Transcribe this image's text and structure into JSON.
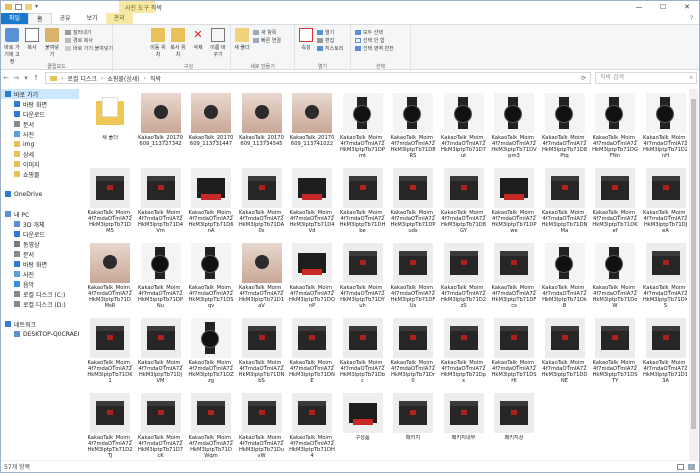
{
  "window": {
    "title": "직박",
    "context_tab": "사진 도구",
    "minimize": "—",
    "maximize": "☐",
    "close": "✕"
  },
  "ribbon_tabs": [
    "파일",
    "홈",
    "공유",
    "보기",
    "관리"
  ],
  "ribbon": {
    "clipboard": {
      "pin": "바로 가기에 고정",
      "copy": "복사",
      "paste": "붙여넣기",
      "cut": "잘라내기",
      "copy_path": "경로 복사",
      "paste_shortcut": "바로 가기 붙여넣기",
      "label": "클립보드"
    },
    "organize": {
      "move": "이동 위치",
      "copyto": "복사 위치",
      "delete": "삭제",
      "rename": "이름 바꾸기",
      "label": "구성"
    },
    "new": {
      "new_folder": "새 폴더",
      "new_item": "새 항목",
      "easy_access": "빠른 연결",
      "label": "새로 만들기"
    },
    "open": {
      "properties": "속성",
      "open": "열기",
      "edit": "편집",
      "history": "히스토리",
      "label": "열기"
    },
    "select": {
      "select_all": "모두 선택",
      "select_none": "선택 안 함",
      "invert": "선택 영역 반전",
      "label": "선택"
    }
  },
  "address": {
    "path": [
      "로컬 디스크",
      "쇼핑몰(상세)",
      "직박"
    ],
    "search_placeholder": "직박 검색"
  },
  "nav": [
    {
      "label": "바로 가기",
      "icon": "star-icon",
      "level": 0,
      "sel": true
    },
    {
      "label": "바탕 화면",
      "icon": "desktop-icon",
      "level": 1
    },
    {
      "label": "다운로드",
      "icon": "download-icon",
      "level": 1
    },
    {
      "label": "문서",
      "icon": "document-icon",
      "level": 1
    },
    {
      "label": "사진",
      "icon": "picture-icon",
      "level": 1
    },
    {
      "label": "img",
      "icon": "folder-icon",
      "level": 1
    },
    {
      "label": "상세",
      "icon": "folder-icon",
      "level": 1
    },
    {
      "label": "이미지",
      "icon": "folder-icon",
      "level": 1
    },
    {
      "label": "쇼핑몰",
      "icon": "folder-icon",
      "level": 1
    },
    {
      "label": "",
      "icon": "",
      "level": 0
    },
    {
      "label": "OneDrive",
      "icon": "cloud-icon",
      "level": 0
    },
    {
      "label": "",
      "icon": "",
      "level": 0
    },
    {
      "label": "내 PC",
      "icon": "pc-icon",
      "level": 0
    },
    {
      "label": "3D 개체",
      "icon": "cube-icon",
      "level": 1
    },
    {
      "label": "다운로드",
      "icon": "download-icon",
      "level": 1
    },
    {
      "label": "동영상",
      "icon": "video-icon",
      "level": 1
    },
    {
      "label": "문서",
      "icon": "document-icon",
      "level": 1
    },
    {
      "label": "바탕 화면",
      "icon": "desktop-icon",
      "level": 1
    },
    {
      "label": "사진",
      "icon": "picture-icon",
      "level": 1
    },
    {
      "label": "음악",
      "icon": "music-icon",
      "level": 1
    },
    {
      "label": "로컬 디스크 (C:)",
      "icon": "drive-icon",
      "level": 1
    },
    {
      "label": "로컬 디스크 (D:)",
      "icon": "drive-icon",
      "level": 1
    },
    {
      "label": "",
      "icon": "",
      "level": 0
    },
    {
      "label": "네트워크",
      "icon": "network-icon",
      "level": 0
    },
    {
      "label": "DESKTOP-Q0CRAEI",
      "icon": "pc-icon",
      "level": 1
    }
  ],
  "files": [
    {
      "name": "새 폴더",
      "kind": "folder"
    },
    {
      "name": "KakaoTalk_20170609_113727342",
      "kind": "hand"
    },
    {
      "name": "KakaoTalk_20170609_113731447",
      "kind": "hand"
    },
    {
      "name": "KakaoTalk_20170609_113734545",
      "kind": "hand"
    },
    {
      "name": "KakaoTalk_20170609_113741022",
      "kind": "hand"
    },
    {
      "name": "KakaoTalk_Moim_4f7mdaOTmIA72HkM3lptpTb71DPmt",
      "kind": "watch"
    },
    {
      "name": "KakaoTalk_Moim_4f7mdaOTmIA72HkM3lptpTb71D8RS",
      "kind": "watch"
    },
    {
      "name": "KakaoTalk_Moim_4f7mdaOTmIA72HkM3lptpTb71D7ut",
      "kind": "watch"
    },
    {
      "name": "KakaoTalk_Moim_4f7mdaOTmIA72HkM3lptpTb71DVpm3",
      "kind": "watch"
    },
    {
      "name": "KakaoTalk_Moim_4f7mdaOTmIA72HkM3lptpTb71D8Ptq",
      "kind": "watch"
    },
    {
      "name": "KakaoTalk_Moim_4f7mdaOTmIA72HkM3lptpTb71DGFNn",
      "kind": "watch"
    },
    {
      "name": "KakaoTalk_Moim_4f7mdaOTmIA72HkM3lptpTb71D2nH",
      "kind": "watch"
    },
    {
      "name": "KakaoTalk_Moim_4f7mdaOTmIA72HkM3lptpTb71DM5",
      "kind": "box"
    },
    {
      "name": "KakaoTalk_Moim_4f7mdaOTmIA72HkM3lptpTb71D4Vm",
      "kind": "box"
    },
    {
      "name": "KakaoTalk_Moim_4f7mdaOTmIA72HkM3lptpTb71D6nA",
      "kind": "redbox"
    },
    {
      "name": "KakaoTalk_Moim_4f7mdaOTmIA72HkM3lptpTb71DA0s",
      "kind": "box"
    },
    {
      "name": "KakaoTalk_Moim_4f7mdaOTmIA72HkM3lptpTb71D4Vd",
      "kind": "redbox"
    },
    {
      "name": "KakaoTalk_Moim_4f7mdaOTmIA72HkM3lptpTb71DHbe",
      "kind": "box"
    },
    {
      "name": "KakaoTalk_Moim_4f7mdaOTmIA72HkM3lptpTb71DPuds",
      "kind": "box"
    },
    {
      "name": "KakaoTalk_Moim_4f7mdaOTmIA72HkM3lptpTb71D8GY",
      "kind": "box"
    },
    {
      "name": "KakaoTalk_Moim_4f7mdaOTmIA72HkM3lptpTb71DPwe",
      "kind": "redbox"
    },
    {
      "name": "KakaoTalk_Moim_4f7mdaOTmIA72HkM3lptpTb71DNMa",
      "kind": "box"
    },
    {
      "name": "KakaoTalk_Moim_4f7mdaOTmIA72HkM3lptpTb71DKef",
      "kind": "box"
    },
    {
      "name": "KakaoTalk_Moim_4f7mdaOTmIA72HkM3lptpTb71DJeA",
      "kind": "box"
    },
    {
      "name": "KakaoTalk_Moim_4f7mdaOTmIA72HkM3lptpTb71DMsR",
      "kind": "hand"
    },
    {
      "name": "KakaoTalk_Moim_4f7mdaOTmIA72HkM3lptpTb71DPNu",
      "kind": "watch"
    },
    {
      "name": "KakaoTalk_Moim_4f7mdaOTmIA72HkM3lptpTb71DSqv",
      "kind": "watch"
    },
    {
      "name": "KakaoTalk_Moim_4f7mdaOTmIA72HkM3lptpTb71D1aV",
      "kind": "hand"
    },
    {
      "name": "KakaoTalk_Moim_4f7mdaOTmIA72HkM3lptpTb71DQnP",
      "kind": "redbox"
    },
    {
      "name": "KakaoTalk_Moim_4f7mdaOTmIA72HkM3lptpTb71DYuh",
      "kind": "box"
    },
    {
      "name": "KakaoTalk_Moim_4f7mdaOTmIA72HkM3lptpTb71DFUs",
      "kind": "box"
    },
    {
      "name": "KakaoTalk_Moim_4f7mdaOTmIA72HkM3lptpTb71D2zS",
      "kind": "box"
    },
    {
      "name": "KakaoTalk_Moim_4f7mdaOTmIA72HkM3lptpTb71DFcs",
      "kind": "box"
    },
    {
      "name": "KakaoTalk_Moim_4f7mdaOTmIA72HkM3lptpTb71DkB",
      "kind": "watch"
    },
    {
      "name": "KakaoTalk_Moim_4f7mdaOTmIA72HkM3lptpTb71DoW",
      "kind": "watch"
    },
    {
      "name": "KakaoTalk_Moim_4f7mdaOTmIA72HkM3lptpTb71DXS",
      "kind": "box"
    },
    {
      "name": "KakaoTalk_Moim_4f7mdaOTmIA72HkM3lptpTb71DK1",
      "kind": "box"
    },
    {
      "name": "KakaoTalk_Moim_4f7mdaOTmIA72HkM3lptpTb71DjVM",
      "kind": "box"
    },
    {
      "name": "KakaoTalk_Moim_4f7mdaOTmIA72HkM3lptpTb71DZzg",
      "kind": "watch"
    },
    {
      "name": "KakaoTalk_Moim_4f7mdaOTmIA72HkM3lptpTb71DNbS",
      "kind": "box"
    },
    {
      "name": "KakaoTalk_Moim_4f7mdaOTmIA72HkM3lptpTb71DNE",
      "kind": "box"
    },
    {
      "name": "KakaoTalk_Moim_4f7mdaOTmIA72HkM3lptpTb71Dbc",
      "kind": "box"
    },
    {
      "name": "KakaoTalk_Moim_4f7mdaOTmIA72HkM3lptpTb71Dr0",
      "kind": "box"
    },
    {
      "name": "KakaoTalk_Moim_4f7mdaOTmIA72HkM3lptpTb71Dpx",
      "kind": "box"
    },
    {
      "name": "KakaoTalk_Moim_4f7mdaOTmIA72HkM3lptpTb71DSHI",
      "kind": "box"
    },
    {
      "name": "KakaoTalk_Moim_4f7mdaOTmIA72HkM3lptpTb71DDNE",
      "kind": "box"
    },
    {
      "name": "KakaoTalk_Moim_4f7mdaOTmIA72HkM3lptpTb71DSTY",
      "kind": "box"
    },
    {
      "name": "KakaoTalk_Moim_4f7mdaOTmIA72HkM3lptpTb71D13A",
      "kind": "box"
    },
    {
      "name": "KakaoTalk_Moim_4f7mdaOTmIA72HkM3lptpTb71D2TJ",
      "kind": "box"
    },
    {
      "name": "KakaoTalk_Moim_4f7mdaOTmIA72HkM3lptpTb71D7cK",
      "kind": "box"
    },
    {
      "name": "KakaoTalk_Moim_4f7mdaOTmIA72HkM3lptpTb71DWqm",
      "kind": "box"
    },
    {
      "name": "KakaoTalk_Moim_4f7mdaOTmIA72HkM3lptpTb71DuvW",
      "kind": "box"
    },
    {
      "name": "KakaoTalk_Moim_4f7mdaOTmIA72HkM3lptpTb71DH4",
      "kind": "box"
    },
    {
      "name": "구성품",
      "kind": "redbox"
    },
    {
      "name": "패키지",
      "kind": "box"
    },
    {
      "name": "패키지내부",
      "kind": "box"
    },
    {
      "name": "패키지상",
      "kind": "box"
    }
  ],
  "status": {
    "count": "57개 항목"
  },
  "colors": {
    "accent": "#1979ca",
    "selected": "#cce8ff",
    "context": "#f6e9a6"
  }
}
